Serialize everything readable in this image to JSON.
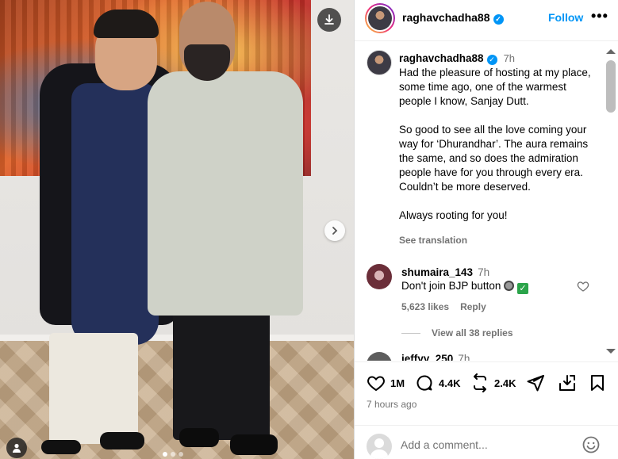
{
  "post": {
    "username": "raghavchadha88",
    "follow_label": "Follow",
    "more_label": "•••",
    "image_dot_count": 3,
    "image_dot_active": 1
  },
  "caption": {
    "username": "raghavchadha88",
    "time": "7h",
    "paragraph1": "Had the pleasure of hosting at my place, some time ago, one of the warmest people I know, Sanjay Dutt.",
    "paragraph2": "So good to see all the love coming your way for ‘Dhurandhar’. The aura remains the same, and so does the admiration people have for you through every era. Couldn’t be more deserved.",
    "paragraph3": "Always rooting for you!",
    "translate_label": "See translation"
  },
  "comments": [
    {
      "username": "shumaira_143",
      "time": "7h",
      "text": "Don't join BJP button",
      "likes": "5,623 likes",
      "reply_label": "Reply",
      "view_replies": "View all 38 replies"
    },
    {
      "username": "jeffyy_250",
      "time": "7h"
    }
  ],
  "actions": {
    "likes": "1M",
    "comments": "4.4K",
    "reposts": "2.4K"
  },
  "posted_time": "7 hours ago",
  "comment_box": {
    "placeholder": "Add a comment..."
  },
  "icons": {
    "download": "download-icon",
    "next": "chevron-right-icon",
    "user_tag": "user-icon",
    "verified": "verified-badge-icon",
    "like": "heart-icon",
    "comment": "comment-bubble-icon",
    "repost": "repost-icon",
    "share": "send-icon",
    "save_collection": "save-to-collection-icon",
    "bookmark": "bookmark-icon",
    "emoji": "emoji-icon"
  },
  "colors": {
    "accent": "#0095f6",
    "muted": "#737373",
    "divider": "#efefef"
  }
}
